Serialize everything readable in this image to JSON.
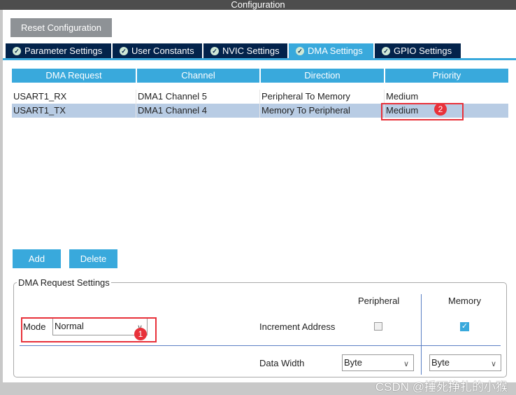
{
  "window": {
    "title": "Configuration"
  },
  "toolbar": {
    "reset_label": "Reset Configuration"
  },
  "tabs": [
    {
      "label": "Parameter Settings"
    },
    {
      "label": "User Constants"
    },
    {
      "label": "NVIC Settings"
    },
    {
      "label": "DMA Settings",
      "active": true
    },
    {
      "label": "GPIO Settings"
    }
  ],
  "table": {
    "headers": [
      "DMA Request",
      "Channel",
      "Direction",
      "Priority"
    ],
    "rows": [
      [
        "USART1_RX",
        "DMA1 Channel 5",
        "Peripheral To Memory",
        "Medium"
      ],
      [
        "USART1_TX",
        "DMA1 Channel 4",
        "Memory To Peripheral",
        "Medium"
      ]
    ],
    "selected_row": 1
  },
  "buttons": {
    "add": "Add",
    "delete": "Delete"
  },
  "settings": {
    "legend": "DMA Request Settings",
    "mode_label": "Mode",
    "mode_value": "Normal",
    "peripheral_header": "Peripheral",
    "memory_header": "Memory",
    "increment_label": "Increment Address",
    "increment_peripheral": false,
    "increment_memory": true,
    "data_width_label": "Data Width",
    "data_width_peripheral": "Byte",
    "data_width_memory": "Byte"
  },
  "annotations": {
    "badge1": "1",
    "badge2": "2",
    "color": "#e8313a"
  },
  "watermark": "CSDN @捶死挣扎的小猴",
  "colors": {
    "accent": "#39a9dc",
    "tab_dark": "#03234b",
    "selected_row": "#b8cce4"
  }
}
